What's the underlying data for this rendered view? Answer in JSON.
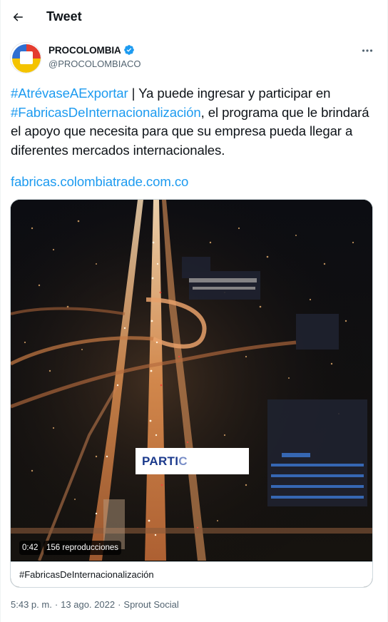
{
  "header": {
    "title": "Tweet"
  },
  "author": {
    "name": "PROCOLOMBIA",
    "handle": "@PROCOLOMBIACO",
    "verified": true
  },
  "tweet": {
    "hashtag_1": "#AtrévaseAExportar",
    "text_1": " | Ya puede ingresar y participar en ",
    "hashtag_2": "#FabricasDeInternacionalización",
    "text_2": ", el programa que le brindará el apoyo que necesita para que su empresa pueda llegar a diferentes mercados internacionales.",
    "link": "fabricas.colombiatrade.com.co"
  },
  "media": {
    "duration": "0:42",
    "views": "156 reproducciones",
    "overlay_text_strong": "PARTI",
    "overlay_text_faded": "C",
    "card_caption": "#FabricasDeInternacionalización"
  },
  "meta": {
    "time": "5:43 p. m.",
    "separator": "·",
    "date": "13 ago. 2022",
    "source": "Sprout Social"
  },
  "colors": {
    "accent": "#1d9bf0",
    "text": "#0f1419",
    "secondary": "#536471",
    "verified": "#1d9bf0"
  }
}
